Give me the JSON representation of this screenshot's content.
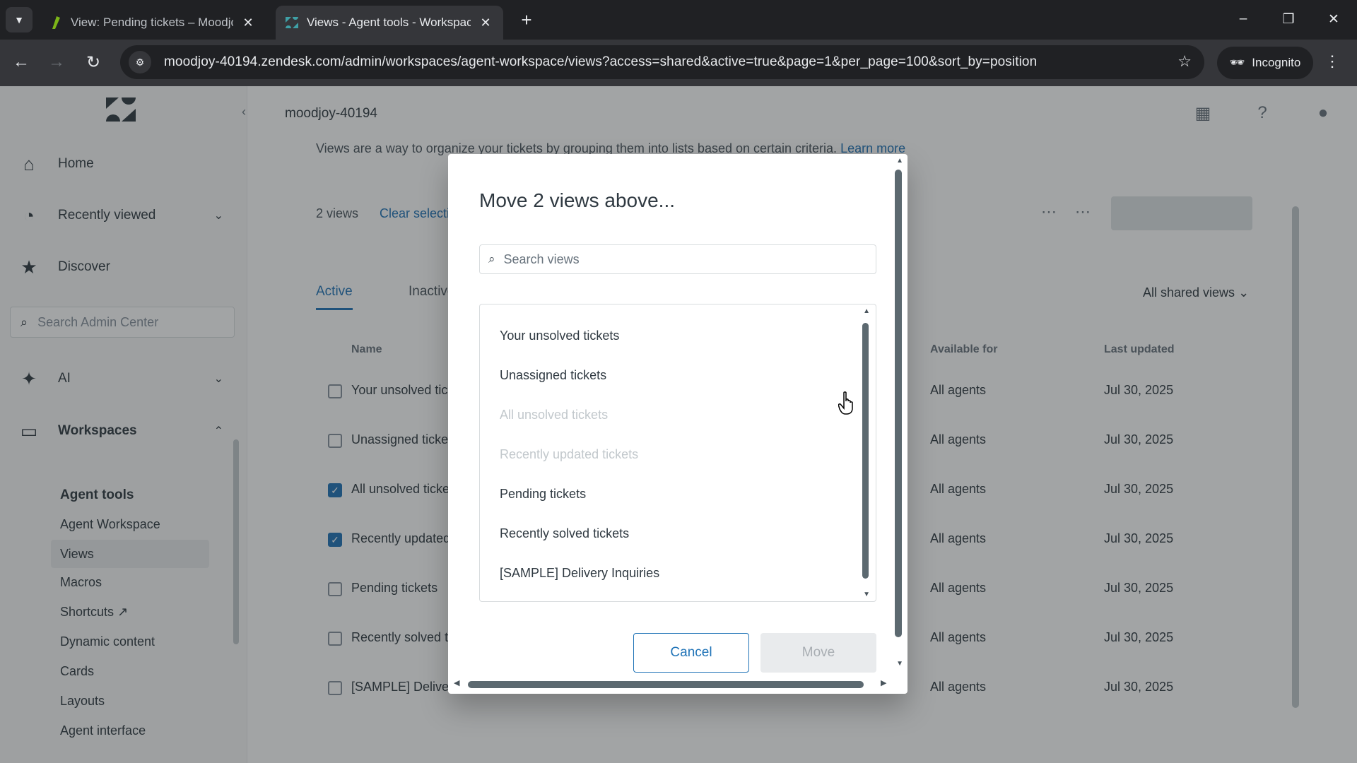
{
  "browser": {
    "tabs": [
      {
        "title": "View: Pending tickets – Moodjo",
        "active": false
      },
      {
        "title": "Views - Agent tools - Workspac",
        "active": true
      }
    ],
    "url": "moodjoy-40194.zendesk.com/admin/workspaces/agent-workspace/views?access=shared&active=true&page=1&per_page=100&sort_by=position",
    "incognito_label": "Incognito"
  },
  "sidebar": {
    "nav": [
      {
        "label": "Home",
        "icon": "home-icon"
      },
      {
        "label": "Recently viewed",
        "icon": "clock-icon"
      },
      {
        "label": "Discover",
        "icon": "star-icon"
      },
      {
        "label": "AI",
        "icon": "sparkle-icon"
      },
      {
        "label": "Workspaces",
        "icon": "monitor-icon"
      }
    ],
    "search_placeholder": "Search Admin Center",
    "section_title": "Agent tools",
    "sub_items": [
      "Agent Workspace",
      "Views",
      "Macros",
      "Shortcuts",
      "Dynamic content",
      "Cards",
      "Layouts",
      "Agent interface"
    ],
    "selected_sub_item": "Views"
  },
  "main": {
    "account_name": "moodjoy-40194",
    "intro_text": "Views are a way to organize your tickets by grouping them into lists based on certain criteria.",
    "learn_more": "Learn more",
    "selected_count": "2 views",
    "clear_selection": "Clear selection",
    "tabs": {
      "active": "Active",
      "inactive": "Inactive"
    },
    "filter_label": "All shared views",
    "columns": {
      "name": "Name",
      "available_for": "Available for",
      "last_updated": "Last updated"
    },
    "rows": [
      {
        "name": "Your unsolved tickets",
        "available": "All agents",
        "updated": "Jul 30, 2025",
        "checked": false
      },
      {
        "name": "Unassigned tickets",
        "available": "All agents",
        "updated": "Jul 30, 2025",
        "checked": false
      },
      {
        "name": "All unsolved tickets",
        "available": "All agents",
        "updated": "Jul 30, 2025",
        "checked": true
      },
      {
        "name": "Recently updated tickets",
        "available": "All agents",
        "updated": "Jul 30, 2025",
        "checked": true
      },
      {
        "name": "Pending tickets",
        "available": "All agents",
        "updated": "Jul 30, 2025",
        "checked": false
      },
      {
        "name": "Recently solved tickets",
        "available": "All agents",
        "updated": "Jul 30, 2025",
        "checked": false
      },
      {
        "name": "[SAMPLE] Delivery Inquiries",
        "available": "All agents",
        "updated": "Jul 30, 2025",
        "checked": false
      }
    ]
  },
  "modal": {
    "title": "Move 2 views above...",
    "search_placeholder": "Search views",
    "options": [
      {
        "label": "Your unsolved tickets",
        "disabled": false
      },
      {
        "label": "Unassigned tickets",
        "disabled": false
      },
      {
        "label": "All unsolved tickets",
        "disabled": true
      },
      {
        "label": "Recently updated tickets",
        "disabled": true
      },
      {
        "label": "Pending tickets",
        "disabled": false
      },
      {
        "label": "Recently solved tickets",
        "disabled": false
      },
      {
        "label": "[SAMPLE] Delivery Inquiries",
        "disabled": false
      }
    ],
    "cancel_label": "Cancel",
    "move_label": "Move"
  },
  "colors": {
    "accent": "#1f73b7",
    "sidebar_bg": "#f8f9f9",
    "chrome_dark": "#202124",
    "chrome_toolbar": "#35363a"
  }
}
